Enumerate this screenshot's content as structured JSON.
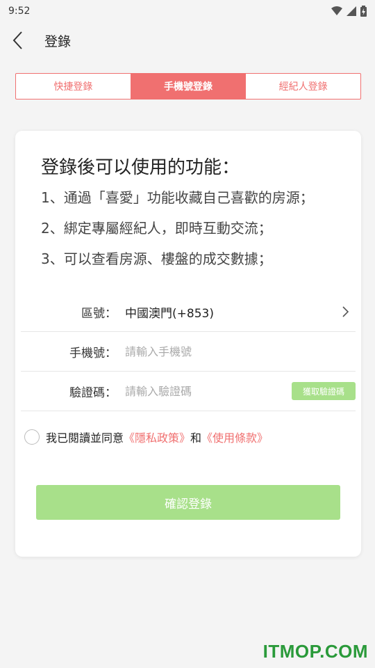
{
  "status_bar": {
    "time": "9:52"
  },
  "app_bar": {
    "title": "登錄"
  },
  "tabs": [
    {
      "label": "快捷登錄",
      "active": false
    },
    {
      "label": "手機號登錄",
      "active": true
    },
    {
      "label": "經紀人登錄",
      "active": false
    }
  ],
  "card": {
    "heading": "登錄後可以使用的功能：",
    "features": [
      "1、通過「喜愛」功能收藏自己喜歡的房源；",
      "2、綁定專屬經紀人，即時互動交流；",
      "3、可以查看房源、樓盤的成交數據；"
    ]
  },
  "form": {
    "region_label": "區號：",
    "region_value": "中國澳門(+853)",
    "phone_label": "手機號：",
    "phone_placeholder": "請輸入手機號",
    "phone_value": "",
    "code_label": "驗證碼：",
    "code_placeholder": "請輸入驗證碼",
    "code_value": "",
    "get_code_label": "獲取驗證碼"
  },
  "agreement": {
    "prefix": "我已閱讀並同意",
    "privacy_link": "《隱私政策》",
    "and": "和",
    "terms_link": "《使用條款》"
  },
  "submit_label": "確認登錄",
  "watermark": "ITMOP.COM",
  "colors": {
    "accent": "#f07070",
    "disabled_green": "#a8e08a",
    "watermark_green": "#2a9a3a"
  }
}
